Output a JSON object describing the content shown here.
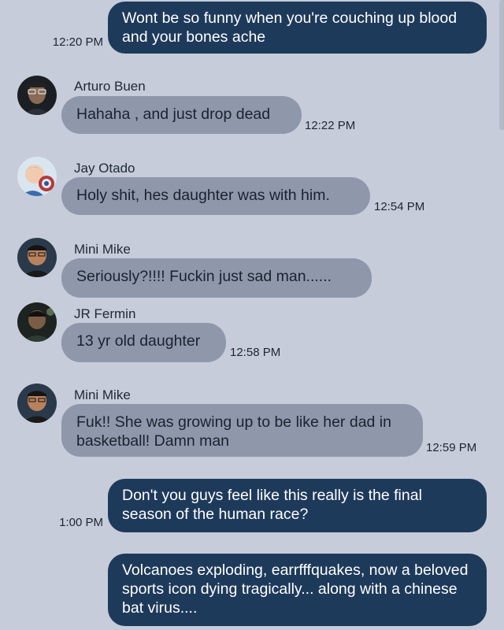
{
  "messages": [
    {
      "kind": "out",
      "text": "Wont be so funny when you're couching up blood and your bones ache",
      "time": "12:20 PM"
    },
    {
      "kind": "in",
      "sender": "Arturo Buen",
      "text": "Hahaha , and just drop dead",
      "time": "12:22 PM",
      "avatar": "avatar-arturo"
    },
    {
      "kind": "in",
      "sender": "Jay Otado",
      "text": "Holy shit, hes daughter was with him.",
      "time": "12:54 PM",
      "avatar": "avatar-jay"
    },
    {
      "kind": "in",
      "sender": "Mini Mike",
      "text": "Seriously?!!!! Fuckin just sad man......",
      "time": "",
      "avatar": "avatar-mike"
    },
    {
      "kind": "in",
      "sender": "JR Fermin",
      "text": "13 yr old daughter",
      "time": "12:58 PM",
      "avatar": "avatar-jr"
    },
    {
      "kind": "in",
      "sender": "Mini Mike",
      "text": "Fuk!! She was growing up to be like her dad in basketball! Damn man",
      "time": "12:59 PM",
      "avatar": "avatar-mike"
    },
    {
      "kind": "out",
      "text": "Don't you guys feel like this really is the final season of the human race?",
      "time": "1:00 PM"
    },
    {
      "kind": "out",
      "text": "Volcanoes exploding, earrfffquakes, now a beloved sports icon dying tragically... along with a chinese bat virus....",
      "time": ""
    }
  ],
  "colors": {
    "background": "#c6ccda",
    "outgoing_bubble": "#1e3a5b",
    "incoming_bubble": "#8f98aa"
  }
}
